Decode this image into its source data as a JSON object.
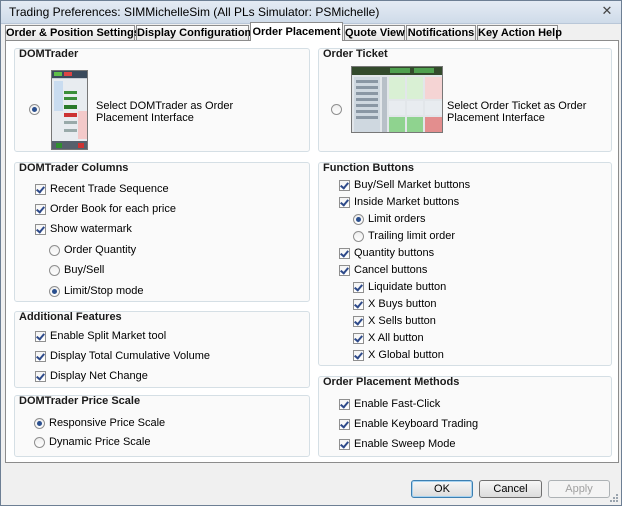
{
  "window": {
    "title": "Trading Preferences: SIMMichelleSim (All PLs Simulator: PSMichelle)",
    "close": "✕"
  },
  "tabs": [
    {
      "label": "Order & Position Settings"
    },
    {
      "label": "Display Configuration"
    },
    {
      "label": "Order Placement",
      "active": true
    },
    {
      "label": "Quote View"
    },
    {
      "label": "Notifications"
    },
    {
      "label": "Key Action Help"
    }
  ],
  "domtrader": {
    "title": "DOMTrader",
    "option_label_line1": "Select DOMTrader as Order",
    "option_label_line2": "Placement Interface",
    "selected": true
  },
  "order_ticket": {
    "title": "Order Ticket",
    "option_label_line1": "Select Order Ticket as Order",
    "option_label_line2": "Placement Interface",
    "selected": false
  },
  "domtrader_columns": {
    "title": "DOMTrader Columns",
    "recent_trade_sequence": "Recent Trade Sequence",
    "order_book": "Order Book for each price",
    "show_watermark": "Show watermark",
    "order_quantity": "Order Quantity",
    "buy_sell": "Buy/Sell",
    "limit_stop_mode": "Limit/Stop mode"
  },
  "additional_features": {
    "title": "Additional Features",
    "split_market": "Enable Split Market tool",
    "total_cumulative_volume": "Display Total Cumulative Volume",
    "net_change": "Display Net Change"
  },
  "price_scale": {
    "title": "DOMTrader Price Scale",
    "responsive": "Responsive Price Scale",
    "dynamic": "Dynamic Price Scale"
  },
  "function_buttons": {
    "title": "Function Buttons",
    "buy_sell_market": "Buy/Sell Market buttons",
    "inside_market": "Inside Market buttons",
    "limit_orders": "Limit orders",
    "trailing_limit": "Trailing limit order",
    "quantity": "Quantity buttons",
    "cancel": "Cancel buttons",
    "liquidate": "Liquidate button",
    "x_buys": "X Buys button",
    "x_sells": "X Sells button",
    "x_all": "X All button",
    "x_global": "X Global button"
  },
  "placement_methods": {
    "title": "Order Placement Methods",
    "fast_click": "Enable Fast-Click",
    "keyboard_trading": "Enable Keyboard Trading",
    "sweep_mode": "Enable Sweep Mode"
  },
  "buttons": {
    "ok": "OK",
    "cancel": "Cancel",
    "apply": "Apply"
  }
}
